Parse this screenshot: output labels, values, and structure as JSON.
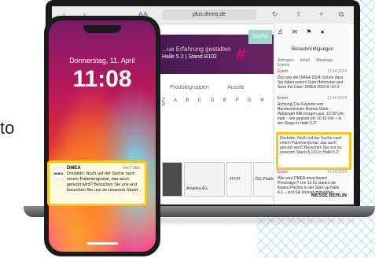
{
  "side_text": "to",
  "browser": {
    "url": "plus.dmea.de",
    "aa": "AA",
    "back": "‹",
    "forward": "›"
  },
  "banner": {
    "title": "...ue Erfahrung gestalten",
    "subtitle": "Halle 5.2 | Stand B102"
  },
  "suche_label": "Suche",
  "tabs": [
    "Produktgruppen",
    "Ausste"
  ],
  "alphabet": "Z A B C D E F G H I J K L M N O P",
  "tiles": [
    {
      "label": ""
    },
    {
      "label": ""
    },
    {
      "label": "Amadea AG"
    },
    {
      "label": "-H-HIT"
    },
    {
      "label": "GG-Plattfor."
    }
  ],
  "notifications_panel": {
    "title": "Benachrichtigungen",
    "tabs": [
      "Anfragen",
      "Inhalt",
      "Meetings",
      "Events"
    ],
    "items": [
      {
        "tag": "Event",
        "date": "11.04.2024",
        "text": "Das war die DMEA 2024! Schön dass Sie dabei waren! Gute Heimreise und Save the Date: DMEA 2025 8.-10.4."
      },
      {
        "tag": "Event",
        "date": "11.04.2024",
        "text": "Achtung! Die Keynote von Bundesminister Bettina Stark-Watzinger fällt morgen aus. 12:30 Uhr statt – wie geplant um 10:10 Uhr – in der Stage in Halle 3.2!"
      },
      {
        "tag": "Event",
        "date": "11.04.2024",
        "text": "Wer wird DMEA nova Award Preisträger? Um 11:15 starten die finalen Pitches in der Start-up Halle 4.1 – und Sie können mitwählen."
      }
    ],
    "highlight": "Docbildo: Noch auf der Suche nach einem Patientenportal, das auch genutzt wird? Besuchen Sie uns an unserem Stand A 102 in Halle 5.2!"
  },
  "messe": "MESSE BERLIN",
  "phone": {
    "date": "Donnerstag, 11. April",
    "time": "11:08"
  },
  "phone_notification": {
    "app": "DMEA",
    "time": "Vor 7 Min.",
    "logo": "DMEA",
    "body": "Docbildo: Noch auf der Suche nach einem Patientenportal, das auch genutzt wird? Besuchen Sie uns und besuchen Sie uns an unserem Stand..."
  }
}
